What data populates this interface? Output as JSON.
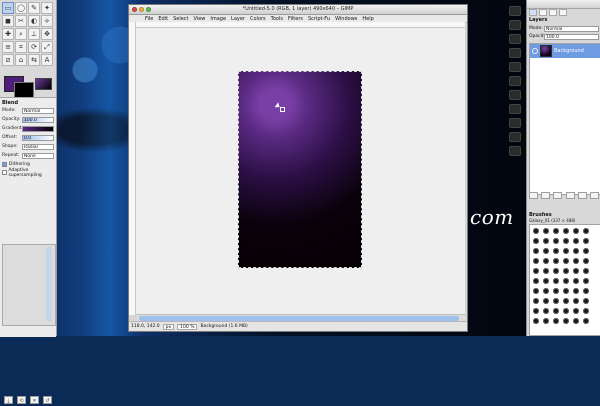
{
  "image_window": {
    "title": "*Untitled-5.0 (RGB, 1 layer) 490x640 – GIMP",
    "menu": [
      "File",
      "Edit",
      "Select",
      "View",
      "Image",
      "Layer",
      "Colors",
      "Tools",
      "Filters",
      "Script-Fu",
      "Windows",
      "Help"
    ],
    "status": {
      "coords": "118.0, 142.0",
      "units": "px",
      "zoom": "100 %",
      "layer_info": "Background (1.6 MB)"
    }
  },
  "toolbox": {
    "tool_options": {
      "title": "Blend",
      "mode_label": "Mode:",
      "mode_value": "Normal",
      "opacity_label": "Opacity:",
      "opacity_value": "100.0",
      "gradient_label": "Gradient:",
      "offset_label": "Offset:",
      "offset_value": "0.0",
      "shape_label": "Shape:",
      "shape_value": "Radial",
      "repeat_label": "Repeat:",
      "repeat_value": "None",
      "dithering_label": "Dithering",
      "adaptive_label": "Adaptive supersampling"
    }
  },
  "layers_dock": {
    "title": "Layers",
    "mode_label": "Mode:",
    "mode_value": "Normal",
    "opacity_label": "Opacity:",
    "opacity_value": "100.0",
    "layer_name": "Background"
  },
  "brushes_dock": {
    "title": "Brushes",
    "info": "Galaxy_01 (337 × 488)"
  },
  "desktop": {
    "watermark": "com"
  },
  "colors": {
    "foreground": "#4f1e78",
    "background": "#000000"
  }
}
